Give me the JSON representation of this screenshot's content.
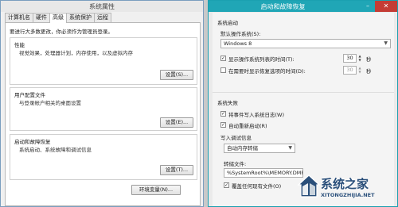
{
  "left": {
    "title": "系统属性",
    "tabs": [
      "计算机名",
      "硬件",
      "高级",
      "系统保护",
      "远程"
    ],
    "notice": "要进行大多数更改，你必须作为管理员登录。",
    "performance": {
      "title": "性能",
      "desc": "视觉效果，处理器计划，内存使用，以及虚拟内存",
      "button": "设置(S)..."
    },
    "profiles": {
      "title": "用户配置文件",
      "desc": "与登录帐户相关的桌面设置",
      "button": "设置(E)..."
    },
    "startup": {
      "title": "启动和故障恢复",
      "desc": "系统启动、系统故障和调试信息",
      "button": "设置(T)..."
    },
    "env_button": "环境变量(N)..."
  },
  "right": {
    "title": "启动和故障恢复",
    "close_glyph": "✕",
    "min_glyph": "–",
    "system_startup": "系统启动",
    "default_os_label": "默认操作系统(S):",
    "default_os_value": "Windows 8",
    "show_os_list": "显示操作系统列表的时间(T):",
    "show_os_list_value": "30",
    "show_recovery": "在需要时显示恢复选项的时间(D):",
    "show_recovery_value": "30",
    "seconds": "秒",
    "system_failure": "系统失败",
    "write_event": "将事件写入系统日志(W)",
    "auto_restart": "自动重新启动(R)",
    "write_debug": "写入调试信息",
    "debug_value": "自动内存转储",
    "dump_file_label": "转储文件:",
    "dump_file_value": "%SystemRoot%\\MEMORY.DMP",
    "overwrite": "覆盖任何现有文件(O)"
  },
  "watermark": {
    "text": "系统之家",
    "url": "XITONGZHIJIA.NET"
  },
  "colors": {
    "right_titlebar": "#20a6b6",
    "close": "#c43c35",
    "watermark": "#2a4f7a"
  }
}
